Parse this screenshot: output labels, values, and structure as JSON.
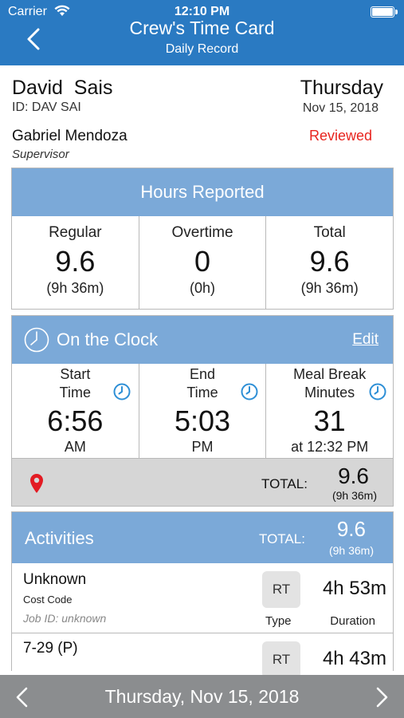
{
  "status_bar": {
    "carrier": "Carrier",
    "time": "12:10 PM"
  },
  "header": {
    "title": "Crew's Time Card",
    "subtitle": "Daily Record"
  },
  "employee": {
    "name": "David  Sais",
    "id": "ID: DAV SAI",
    "day": "Thursday",
    "date": "Nov 15, 2018",
    "supervisor_name": "Gabriel Mendoza",
    "supervisor_label": "Supervisor",
    "status": "Reviewed"
  },
  "colors": {
    "header_blue": "#2a7ac2",
    "card_blue": "#7ba9d8",
    "status_red": "#e8241e",
    "clock_icon_blue": "#2e8fd6",
    "pin_red": "#e31b23"
  },
  "hours": {
    "title": "Hours Reported",
    "columns": [
      {
        "label": "Regular",
        "value": "9.6",
        "detail": "(9h 36m)"
      },
      {
        "label": "Overtime",
        "value": "0",
        "detail": "(0h)"
      },
      {
        "label": "Total",
        "value": "9.6",
        "detail": "(9h 36m)"
      }
    ]
  },
  "clock": {
    "title": "On the Clock",
    "edit_label": "Edit",
    "start": {
      "label_line1": "Start",
      "label_line2": "Time",
      "value": "6:56",
      "detail": "AM"
    },
    "end": {
      "label_line1": "End",
      "label_line2": "Time",
      "value": "5:03",
      "detail": "PM"
    },
    "meal": {
      "label_line1": "Meal Break",
      "label_line2": "Minutes",
      "value": "31",
      "detail": "at 12:32 PM"
    },
    "total_label": "TOTAL:",
    "total_value": "9.6",
    "total_detail": "(9h 36m)"
  },
  "activities": {
    "title": "Activities",
    "total_label": "TOTAL:",
    "total_value": "9.6",
    "total_detail": "(9h 36m)",
    "rows": [
      {
        "name": "Unknown",
        "cost_code": "Cost Code",
        "job": "Job ID: unknown",
        "type": "RT",
        "type_label": "Type",
        "duration": "4h 53m",
        "duration_label": "Duration"
      },
      {
        "name": "7-29 (P)",
        "type": "RT",
        "duration": "4h 43m"
      }
    ]
  },
  "footer": {
    "date": "Thursday, Nov 15, 2018"
  }
}
